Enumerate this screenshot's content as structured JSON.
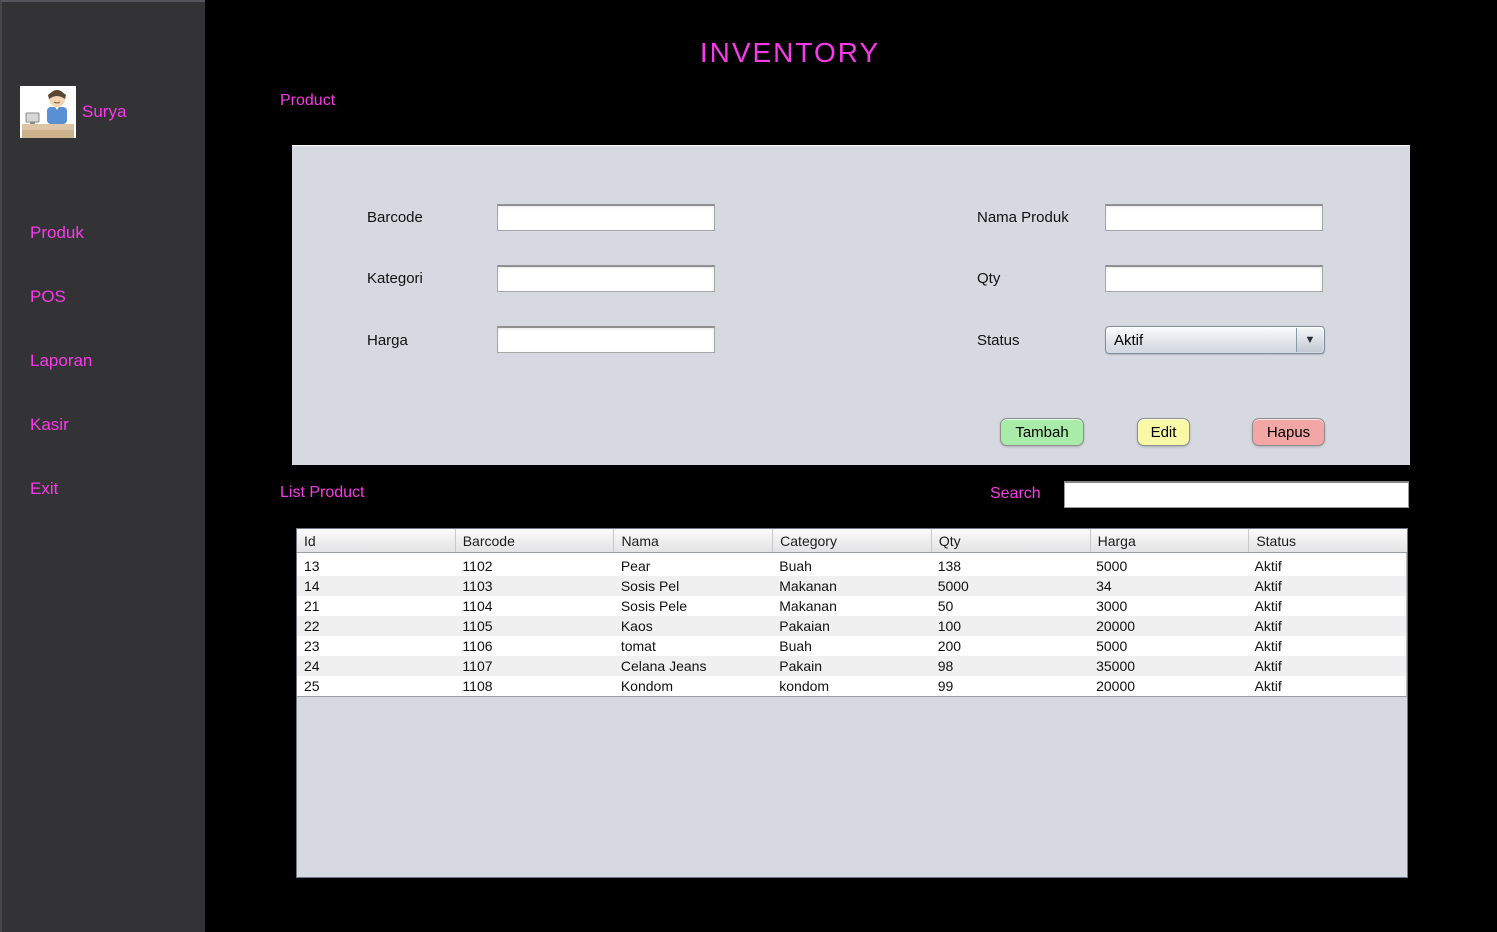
{
  "window": {
    "title": "INVENTORY"
  },
  "colors": {
    "accent": "#f73be8",
    "sidebar-bg": "#333336",
    "panel-bg": "#d6d9e0",
    "table-stripe": "#f0f0f1",
    "btn-tambah": "#a9eca9",
    "btn-edit": "#f8f8a6",
    "btn-hapus": "#f3a6a6"
  },
  "sidebar": {
    "user": {
      "name": "Surya",
      "avatar_icon": "cashier-avatar"
    },
    "items": [
      {
        "label": "Produk"
      },
      {
        "label": "POS"
      },
      {
        "label": "Laporan"
      },
      {
        "label": "Kasir"
      },
      {
        "label": "Exit"
      }
    ]
  },
  "main": {
    "product_section_label": "Product",
    "form": {
      "left_fields": [
        {
          "label": "Barcode",
          "value": "",
          "placeholder": ""
        },
        {
          "label": "Kategori",
          "value": "",
          "placeholder": ""
        },
        {
          "label": "Harga",
          "value": "",
          "placeholder": ""
        }
      ],
      "right_fields": [
        {
          "label": "Nama Produk",
          "value": "",
          "placeholder": ""
        },
        {
          "label": "Qty",
          "value": "",
          "placeholder": ""
        }
      ],
      "status": {
        "label": "Status",
        "value": "Aktif",
        "dropdown_icon": "chevron-down"
      },
      "buttons": [
        {
          "label": "Tambah"
        },
        {
          "label": "Edit"
        },
        {
          "label": "Hapus"
        }
      ]
    },
    "list_product_label": "List Product",
    "search": {
      "label": "Search",
      "value": "",
      "placeholder": ""
    },
    "table": {
      "columns": [
        "Id",
        "Barcode",
        "Nama",
        "Category",
        "Qty",
        "Harga",
        "Status"
      ],
      "rows": [
        [
          "13",
          "1102",
          "Pear",
          "Buah",
          "138",
          "5000",
          "Aktif"
        ],
        [
          "14",
          "1103",
          "Sosis Pel",
          "Makanan",
          "5000",
          "34",
          "Aktif"
        ],
        [
          "21",
          "1104",
          "Sosis Pele",
          "Makanan",
          "50",
          "3000",
          "Aktif"
        ],
        [
          "22",
          "1105",
          "Kaos",
          "Pakaian",
          "100",
          "20000",
          "Aktif"
        ],
        [
          "23",
          "1106",
          "tomat",
          "Buah",
          "200",
          "5000",
          "Aktif"
        ],
        [
          "24",
          "1107",
          "Celana Jeans",
          "Pakain",
          "98",
          "35000",
          "Aktif"
        ],
        [
          "25",
          "1108",
          "Kondom",
          "kondom",
          "99",
          "20000",
          "Aktif"
        ]
      ]
    }
  }
}
